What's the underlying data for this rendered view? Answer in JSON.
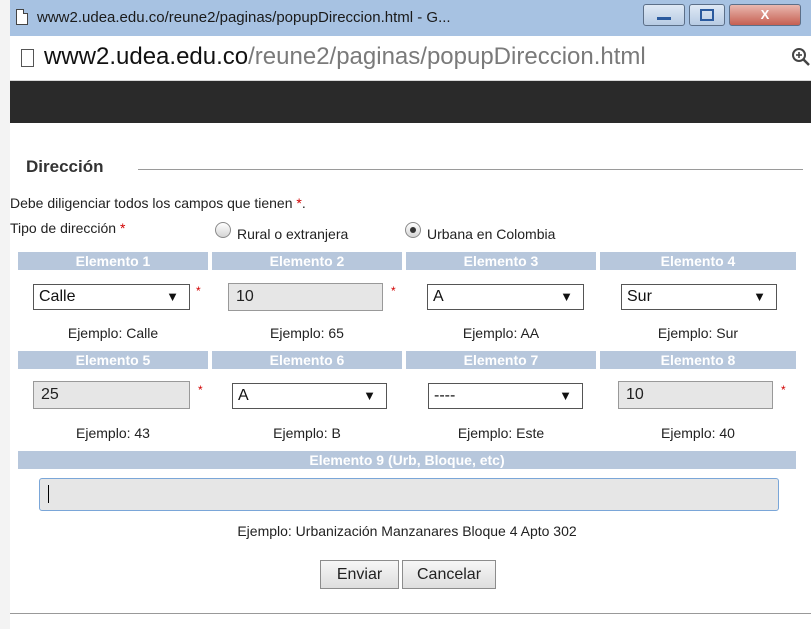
{
  "window": {
    "title": "www2.udea.edu.co/reune2/paginas/popupDireccion.html - G...",
    "close_glyph": "X"
  },
  "address": {
    "host": "www2.udea.edu.co",
    "path": "/reune2/paginas/popupDireccion.html",
    "page_icon": "page-icon",
    "zoom_icon": "zoom-icon"
  },
  "form": {
    "legend": "Dirección",
    "required_note": "Debe diligenciar todos los campos que tienen ",
    "required_star": "*",
    "required_end": ".",
    "tipo_label": "Tipo de dirección ",
    "tipo_star": "*",
    "rural_label": "Rural o extranjera",
    "urbana_label": "Urbana en Colombia",
    "selected_type": "Urbana en Colombia",
    "elements": [
      {
        "header": "Elemento 1",
        "value": "Calle",
        "kind": "select",
        "required": true,
        "example": "Ejemplo: Calle"
      },
      {
        "header": "Elemento 2",
        "value": "10",
        "kind": "text",
        "required": true,
        "example": "Ejemplo: 65"
      },
      {
        "header": "Elemento 3",
        "value": "A",
        "kind": "select",
        "required": false,
        "example": "Ejemplo: AA"
      },
      {
        "header": "Elemento 4",
        "value": "Sur",
        "kind": "select",
        "required": false,
        "example": "Ejemplo: Sur"
      },
      {
        "header": "Elemento 5",
        "value": "25",
        "kind": "text",
        "required": true,
        "example": "Ejemplo: 43"
      },
      {
        "header": "Elemento 6",
        "value": "A",
        "kind": "select",
        "required": false,
        "example": "Ejemplo: B"
      },
      {
        "header": "Elemento 7",
        "value": "----",
        "kind": "select",
        "required": false,
        "example": "Ejemplo: Este"
      },
      {
        "header": "Elemento 8",
        "value": "10",
        "kind": "text",
        "required": true,
        "example": "Ejemplo: 40"
      }
    ],
    "element9": {
      "header": "Elemento 9 (Urb, Bloque, etc)",
      "value": "",
      "example": "Ejemplo: Urbanización Manzanares Bloque 4 Apto 302"
    },
    "buttons": {
      "submit": "Enviar",
      "cancel": "Cancelar"
    }
  },
  "colors": {
    "header_bg": "#b7c7dc",
    "required": "#d10000",
    "titlebar": "#a7c2e2"
  }
}
